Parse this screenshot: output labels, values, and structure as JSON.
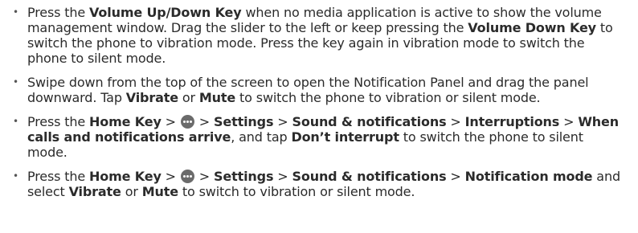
{
  "items": [
    {
      "segments": [
        {
          "t": "Press the ",
          "b": false
        },
        {
          "t": "Volume Up/Down Key",
          "b": true
        },
        {
          "t": " when no media application is active to show the volume management window. Drag the slider to the left or keep pressing the ",
          "b": false
        },
        {
          "t": "Volume Down Key",
          "b": true
        },
        {
          "t": " to switch the phone to vibration mode. Press the key again in vibration mode to switch the phone to silent mode.",
          "b": false
        }
      ]
    },
    {
      "segments": [
        {
          "t": "Swipe down from the top of the screen to open the Notification Panel and drag the panel downward. Tap ",
          "b": false
        },
        {
          "t": "Vibrate",
          "b": true
        },
        {
          "t": " or ",
          "b": false
        },
        {
          "t": "Mute",
          "b": true
        },
        {
          "t": " to switch the phone to vibration or silent mode.",
          "b": false
        }
      ]
    },
    {
      "segments": [
        {
          "t": "Press the ",
          "b": false
        },
        {
          "t": "Home Key",
          "b": true
        },
        {
          "t": " > ",
          "b": false
        },
        {
          "icon": "apps-icon"
        },
        {
          "t": " > ",
          "b": false
        },
        {
          "t": "Settings",
          "b": true
        },
        {
          "t": " > ",
          "b": false
        },
        {
          "t": "Sound & notifications",
          "b": true
        },
        {
          "t": " > ",
          "b": false
        },
        {
          "t": "Interruptions",
          "b": true
        },
        {
          "t": " > ",
          "b": false
        },
        {
          "t": "When calls and notifications arrive",
          "b": true
        },
        {
          "t": ", and tap ",
          "b": false
        },
        {
          "t": "Don’t interrupt",
          "b": true
        },
        {
          "t": " to switch the phone to silent mode.",
          "b": false
        }
      ]
    },
    {
      "segments": [
        {
          "t": "Press the ",
          "b": false
        },
        {
          "t": "Home Key",
          "b": true
        },
        {
          "t": " > ",
          "b": false
        },
        {
          "icon": "apps-icon"
        },
        {
          "t": " > ",
          "b": false
        },
        {
          "t": "Settings",
          "b": true
        },
        {
          "t": " > ",
          "b": false
        },
        {
          "t": "Sound & notifications",
          "b": true
        },
        {
          "t": " > ",
          "b": false
        },
        {
          "t": "Notification mode",
          "b": true
        },
        {
          "t": " and select ",
          "b": false
        },
        {
          "t": "Vibrate",
          "b": true
        },
        {
          "t": " or ",
          "b": false
        },
        {
          "t": "Mute",
          "b": true
        },
        {
          "t": " to switch to vibration or silent mode.",
          "b": false
        }
      ]
    }
  ]
}
